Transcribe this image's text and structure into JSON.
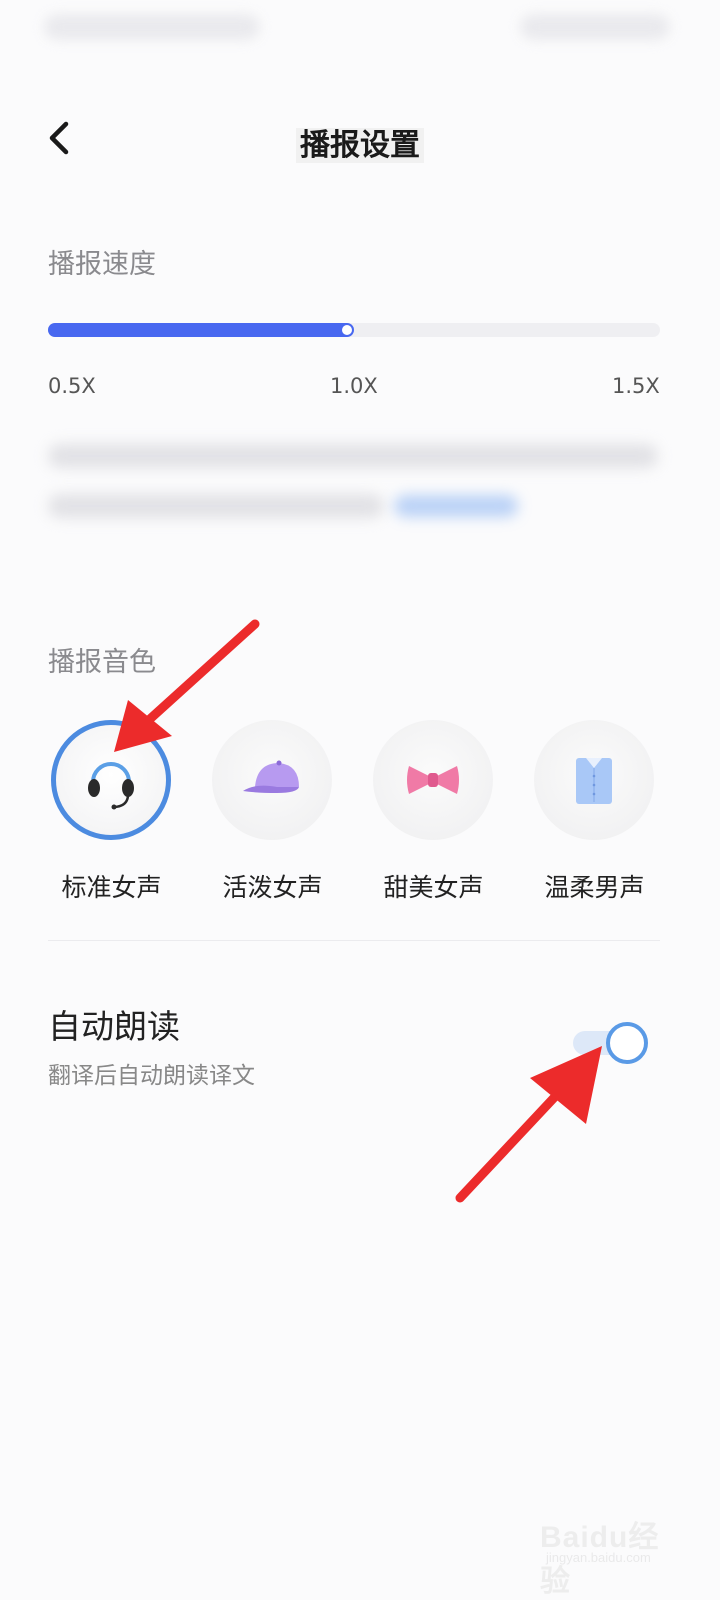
{
  "header": {
    "title": "播报设置"
  },
  "speed_section": {
    "label": "播报速度",
    "min_label": "0.5X",
    "mid_label": "1.0X",
    "max_label": "1.5X",
    "value": 1.0,
    "accent_color": "#4868f0"
  },
  "voice_section": {
    "label": "播报音色",
    "selected_index": 0,
    "options": [
      {
        "label": "标准女声",
        "icon": "headset-icon"
      },
      {
        "label": "活泼女声",
        "icon": "cap-icon"
      },
      {
        "label": "甜美女声",
        "icon": "bow-tie-icon"
      },
      {
        "label": "温柔男声",
        "icon": "shirt-icon"
      }
    ],
    "selected_ring_color": "#4c8be0"
  },
  "auto_read": {
    "title": "自动朗读",
    "subtitle": "翻译后自动朗读译文",
    "enabled": true
  },
  "watermark": {
    "brand": "Baidu经验",
    "url": "jingyan.baidu.com"
  },
  "annotations": {
    "arrow_color": "#ec2b2b"
  }
}
